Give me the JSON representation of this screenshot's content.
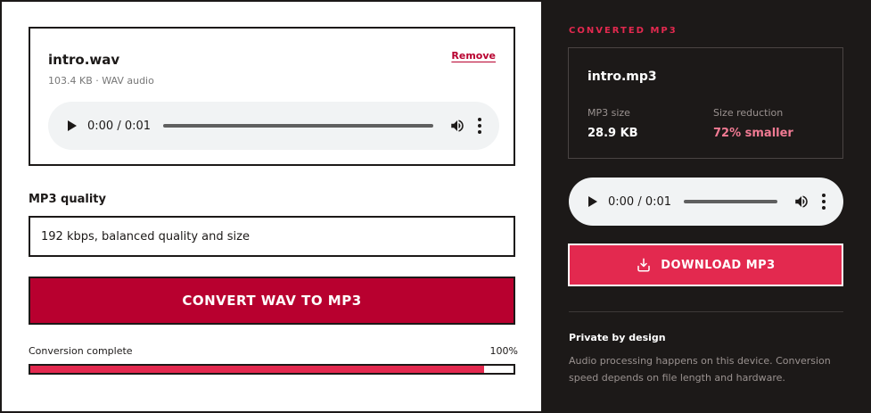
{
  "input_file": {
    "name": "intro.wav",
    "meta": "103.4 KB · WAV audio",
    "remove_label": "Remove",
    "player": {
      "time": "0:00 / 0:01"
    }
  },
  "quality": {
    "label": "MP3 quality",
    "selected": "192 kbps, balanced quality and size"
  },
  "convert_button_label": "CONVERT WAV TO MP3",
  "progress": {
    "label": "Conversion complete",
    "percent_text": "100%",
    "fill_fraction": 0.94
  },
  "output": {
    "heading": "CONVERTED MP3",
    "name": "intro.mp3",
    "size_label": "MP3 size",
    "size_value": "28.9 KB",
    "reduction_label": "Size reduction",
    "reduction_value": "72% smaller",
    "player": {
      "time": "0:00 / 0:01"
    },
    "download_label": "DOWNLOAD MP3"
  },
  "privacy": {
    "title": "Private by design",
    "text": "Audio processing happens on this device. Conversion speed depends on file length and hardware."
  },
  "colors": {
    "accent": "#e3294f",
    "convert_button": "#b8002f",
    "dark_panel": "#1c1918",
    "reduction_text": "#f07a93"
  },
  "icons": {
    "play": "play-icon",
    "volume": "volume-icon",
    "more": "more-vertical-icon",
    "download": "download-icon"
  }
}
